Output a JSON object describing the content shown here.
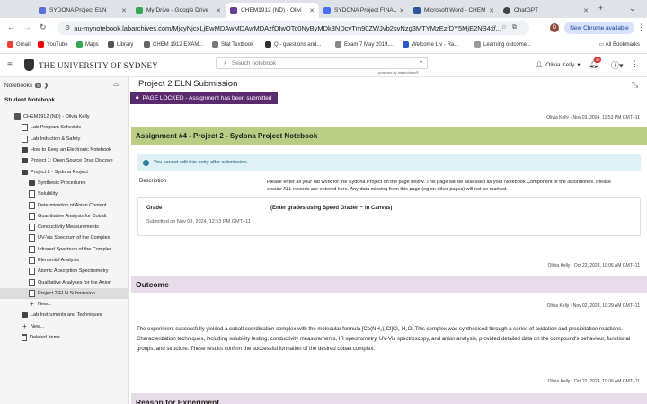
{
  "browser": {
    "tabs": [
      {
        "label": "SYDONA Project ELN",
        "color": "#5b6fd6"
      },
      {
        "label": "My Drive - Google Drive",
        "color": "#34a853"
      },
      {
        "label": "CHEM1912 (ND) - Olivi",
        "color": "#6a3d9a",
        "active": true
      },
      {
        "label": "SYDONA Project FINAL",
        "color": "#4a6cf7"
      },
      {
        "label": "Microsoft Word - CHEM",
        "color": "#2b579a"
      },
      {
        "label": "ChatGPT",
        "color": "#444444"
      }
    ],
    "url": "au-mynotebook.labarchives.com/MjcyNjcxLjEwMDAwMDAwMDAzfDIwOTc0NyByMDk3NDcvTm90ZWJvb2svNzg3MTYMzEzfDY5MjE2NS4x/...",
    "profile_initial": "D",
    "new_chrome_label": "New Chrome available",
    "bookmarks": [
      {
        "label": "Gmail",
        "color": "#ea4335"
      },
      {
        "label": "YouTube",
        "color": "#ff0000"
      },
      {
        "label": "Maps",
        "color": "#34a853"
      },
      {
        "label": "Library",
        "color": "#555555"
      },
      {
        "label": "CHEM 1912 EXAM...",
        "color": "#666666"
      },
      {
        "label": "Stat Textbook",
        "color": "#777777"
      },
      {
        "label": "Q - questions and...",
        "color": "#333333"
      },
      {
        "label": "Exam 7 May 2019,...",
        "color": "#888888"
      },
      {
        "label": "Welcome Liv - Ra...",
        "color": "#2a58c9"
      },
      {
        "label": "Learning outcome...",
        "color": "#999999"
      }
    ],
    "all_bookmarks": "All Bookmarks"
  },
  "app": {
    "university": "THE UNIVERSITY OF SYDNEY",
    "search_placeholder": "Search notebook",
    "powered_by": "powered by labarchives®",
    "user_name": "Olivia Kelly",
    "notification_count": "99"
  },
  "sidebar": {
    "notebooks_label": "Notebooks",
    "notebooks_count": "9",
    "title": "Student Notebook",
    "items": [
      {
        "label": "CHEM1912 (ND) - Olivia Kelly",
        "icon": "nb",
        "level": 0
      },
      {
        "label": "Lab Program Schedule",
        "icon": "page",
        "level": 1
      },
      {
        "label": "Lab Induction & Safety",
        "icon": "page",
        "level": 1
      },
      {
        "label": "How to Keep an Electronic Notebook",
        "icon": "folder",
        "level": 1
      },
      {
        "label": "Project 1: Open Source Drug Discove",
        "icon": "folder",
        "level": 1
      },
      {
        "label": "Project 2 - Sydona Project",
        "icon": "folder",
        "level": 1
      },
      {
        "label": "Synthesis Procedures",
        "icon": "folder",
        "level": 2
      },
      {
        "label": "Solubility",
        "icon": "page",
        "level": 2
      },
      {
        "label": "Determination of Anion Content",
        "icon": "page",
        "level": 2
      },
      {
        "label": "Quantitative Analysis for Cobalt",
        "icon": "page",
        "level": 2
      },
      {
        "label": "Conductivity Measurements",
        "icon": "page",
        "level": 2
      },
      {
        "label": "UV-Vis Spectrum of the Complex",
        "icon": "page",
        "level": 2
      },
      {
        "label": "Infrared Spectrum of the Complex",
        "icon": "page",
        "level": 2
      },
      {
        "label": "Elemental Analysis",
        "icon": "page",
        "level": 2
      },
      {
        "label": "Atomic Absorption Spectrometry",
        "icon": "page",
        "level": 2
      },
      {
        "label": "Qualitative Analyses for the Anion",
        "icon": "page",
        "level": 2
      },
      {
        "label": "Project 2 ELN Submission",
        "icon": "page",
        "level": 2,
        "selected": true
      },
      {
        "label": "New...",
        "icon": "plus",
        "level": 2
      },
      {
        "label": "Lab Instruments and Techniques",
        "icon": "folder",
        "level": 1
      },
      {
        "label": "New...",
        "icon": "plus",
        "level": 1
      },
      {
        "label": "Deleted Items",
        "icon": "trash",
        "level": 1
      }
    ]
  },
  "main": {
    "page_title": "Project 2 ELN Submission",
    "locked_text": "PAGE LOCKED - Assignment has been submitted",
    "stamp1": "Olivia Kelly - Nov 03, 2024, 12:53 PM GMT+11",
    "assignment_title": "Assignment #4 - Project 2 - Sydona Project Notebook",
    "info_text": "You cannot edit this entry after submission.",
    "description_label": "Description",
    "description_text": "Please enter all your lab work for the Sydona Project on the page below. This page will be assessed as your Notebook Component of the laboratories. Please ensure ALL records are entered here. Any data missing from this page (eg on other pages) will not be marked.",
    "grade_label": "Grade",
    "grade_instructions": "(Enter grades using Speed Grader™ in Canvas)",
    "submitted_text": "Submitted on Nov 03, 2024, 12:53 PM GMT+11",
    "stamp2": "Olivia Kelly - Oct 22, 2024, 10:06 AM GMT+11",
    "outcome_title": "Outcome",
    "stamp3": "Olivia Kelly - Nov 02, 2024, 10:29 AM GMT+11",
    "outcome_text": "The experiment successfully yielded a cobalt coordination complex with the molecular formula [Co(NH₃)₅Cl]Cl₂·H₂O. This complex was synthesised through a series of oxidation and precipitation reactions. Characterization techniques, including solubility testing, conductivity measurements, IR spectrometry, UV-Vis spectroscopy, and anion analysis, provided detailed data on the compound's behaviour, functional groups, and structure. These results confirm the successful formation of the desired cobalt complex.",
    "stamp4": "Olivia Kelly - Oct 22, 2024, 10:06 AM GMT+11",
    "reason_title": "Reason for Experiment"
  }
}
